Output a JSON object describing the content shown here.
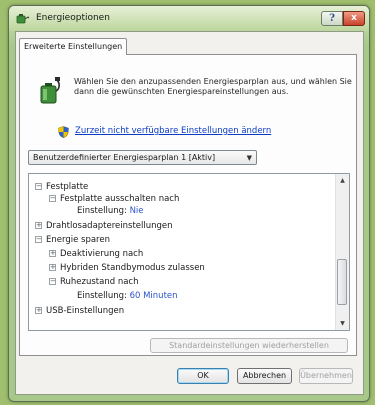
{
  "window": {
    "title": "Energieoptionen",
    "help_label": "?",
    "close_label": "x"
  },
  "tabs": [
    {
      "label": "Erweiterte Einstellungen",
      "active": true
    }
  ],
  "description": "Wählen Sie den anzupassenden Energiesparplan aus, und wählen Sie dann die gewünschten Energiespareinstellungen aus.",
  "restore_link": "Zurzeit nicht verfügbare Einstellungen ändern",
  "plan_select": {
    "value": "Benutzerdefinierter Energiesparplan 1 [Aktiv]"
  },
  "tree": {
    "items": [
      {
        "label": "Festplatte",
        "expander": "−"
      },
      {
        "label": "Festplatte ausschalten nach",
        "expander": "−"
      },
      {
        "label": "Einstellung:",
        "value": "Nie"
      },
      {
        "label": "Drahtlosadaptereinstellungen",
        "expander": "+"
      },
      {
        "label": "Energie sparen",
        "expander": "−"
      },
      {
        "label": "Deaktivierung nach",
        "expander": "+"
      },
      {
        "label": "Hybriden Standbymodus zulassen",
        "expander": "+"
      },
      {
        "label": "Ruhezustand nach",
        "expander": "−"
      },
      {
        "label": "Einstellung:",
        "value": "60 Minuten"
      },
      {
        "label": "USB-Einstellungen",
        "expander": "+"
      }
    ],
    "scrollbar": {
      "up_glyph": "▲",
      "down_glyph": "▼"
    }
  },
  "buttons": {
    "restore_defaults": "Standardeinstellungen wiederherstellen",
    "ok": "OK",
    "cancel": "Abbrechen",
    "apply": "Übernehmen"
  },
  "colors": {
    "background": "#9fbf6f",
    "link": "#0a3cc7",
    "setting_value": "#2a53c8",
    "close_button": "#c9432a"
  },
  "icons": {
    "app": "battery-plug-icon",
    "plan": "battery-plug-icon",
    "shield": "uac-shield-icon"
  }
}
